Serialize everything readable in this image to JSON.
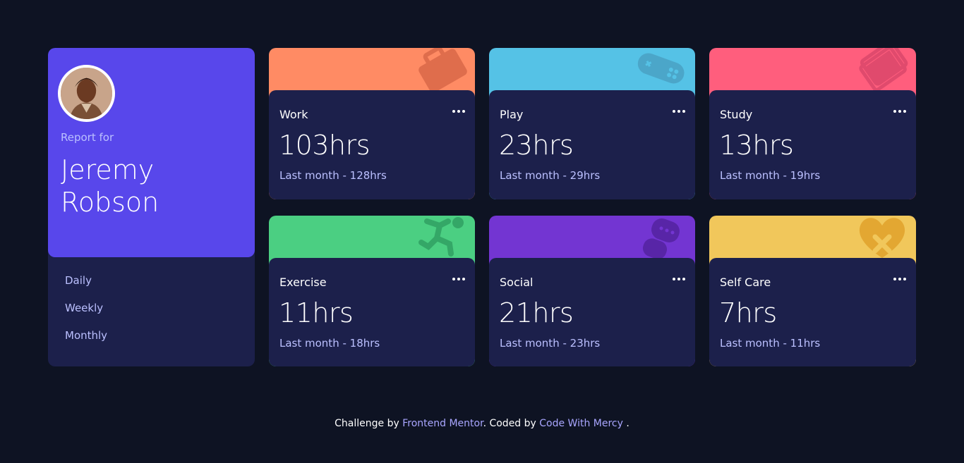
{
  "profile": {
    "report_for": "Report for",
    "name": "Jeremy Robson",
    "tabs": [
      {
        "label": "Daily"
      },
      {
        "label": "Weekly"
      },
      {
        "label": "Monthly"
      }
    ]
  },
  "cards": [
    {
      "title": "Work",
      "hours": "103hrs",
      "previous": "Last month - 128hrs",
      "color": "#ff8b64",
      "icon": "briefcase-icon"
    },
    {
      "title": "Play",
      "hours": "23hrs",
      "previous": "Last month - 29hrs",
      "color": "#55c2e6",
      "icon": "gamepad-icon"
    },
    {
      "title": "Study",
      "hours": "13hrs",
      "previous": "Last month - 19hrs",
      "color": "#ff5e7d",
      "icon": "book-icon"
    },
    {
      "title": "Exercise",
      "hours": "11hrs",
      "previous": "Last month - 18hrs",
      "color": "#4bcf82",
      "icon": "running-icon"
    },
    {
      "title": "Social",
      "hours": "21hrs",
      "previous": "Last month - 23hrs",
      "color": "#7335d2",
      "icon": "chat-bubbles-icon"
    },
    {
      "title": "Self Care",
      "hours": "7hrs",
      "previous": "Last month - 11hrs",
      "color": "#f1c75b",
      "icon": "heart-plaster-icon"
    }
  ],
  "footer": {
    "prefix": "Challenge by",
    "link1": "Frontend Mentor",
    "middle": ". Coded by",
    "link2": "Code With Mercy",
    "suffix": "."
  }
}
